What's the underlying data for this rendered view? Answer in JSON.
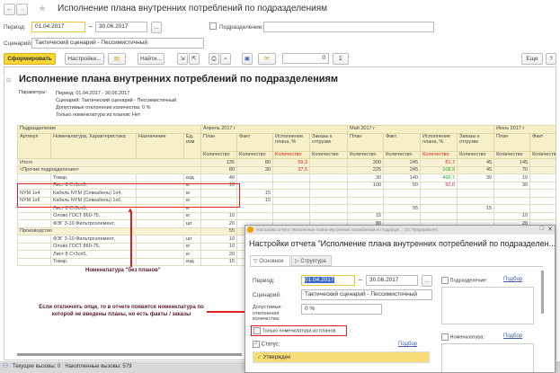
{
  "window": {
    "title": "Исполнение плана внутренних потреблений по подразделениям",
    "nav_back": "←",
    "nav_fwd": "→",
    "star": "★"
  },
  "filters": {
    "period_label": "Период:",
    "date_from": "01.04.2017",
    "date_to": "30.06.2017",
    "dash": "–",
    "dots": "...",
    "division_label": "Подразделение:",
    "division_value": "",
    "scenario_label": "Сценарий:",
    "scenario_value": "Тактический сценарий - Пессимистичный"
  },
  "toolbar": {
    "generate": "Сформировать",
    "settings": "Настройки...",
    "find": "Найти...",
    "sum_value": "0",
    "sigma": "Σ",
    "more": "Еще",
    "help": "?"
  },
  "report": {
    "title": "Исполнение плана внутренних потреблений по подразделениям",
    "params_label": "Параметры:",
    "params": [
      "Период: 01.04.2017 - 30.06.2017",
      "Сценарий: Тактический сценарий - Пессимистичный",
      "Допустимые отклонения количества: 0 %",
      "Только номенклатура из планов: Нет"
    ],
    "header": {
      "division": "Подразделение",
      "article": "Артикул",
      "item": "Номенклатура, Характеристика",
      "purpose": "Назначение",
      "unit": "Ед. изм",
      "months": [
        "Апрель 2017 г",
        "Май 2017 г",
        "Июнь 2017 г"
      ],
      "cols": [
        "План",
        "Факт",
        "Исполнение плана, %",
        "Заказы к отгрузке"
      ],
      "qty": "Количество"
    },
    "rows": [
      {
        "type": "total",
        "article": "Итого",
        "cells": [
          "135",
          "80",
          "59,3",
          "",
          "300",
          "245",
          "81,7",
          "45",
          "145",
          ""
        ]
      },
      {
        "type": "group",
        "article": "<Прочие подразделения>",
        "cells": [
          "80",
          "30",
          "37,5",
          "",
          "225",
          "245",
          "108,9",
          "45",
          "70",
          ""
        ]
      },
      {
        "type": "item",
        "article": "",
        "item": "Товар,",
        "unit": "изд",
        "cells": [
          "40",
          "",
          "",
          "",
          "30",
          "140",
          "466,7",
          "30",
          "10",
          ""
        ]
      },
      {
        "type": "item",
        "article": "",
        "item": "Лист 8 Ст3сп5,",
        "unit": "кг",
        "cells": [
          "10",
          "",
          "",
          "",
          "100",
          "50",
          "50,0",
          "",
          "30",
          ""
        ]
      },
      {
        "type": "item",
        "article": "NYM 1х4",
        "item": "Кабель NYM (Севкабель) 1х4,",
        "unit": "м",
        "cells": [
          "",
          "15",
          "",
          "",
          "",
          "",
          "",
          "",
          "",
          ""
        ]
      },
      {
        "type": "item",
        "article": "NYM 1х6",
        "item": "Кабель NYM (Севкабель) 1х6,",
        "unit": "м",
        "cells": [
          "",
          "15",
          "",
          "",
          "",
          "",
          "",
          "",
          "",
          ""
        ]
      },
      {
        "type": "item",
        "article": "",
        "item": "Лист 8 Ст3сп5,",
        "unit": "кг",
        "cells": [
          "",
          "",
          "",
          "",
          "",
          "55",
          "",
          "15",
          "",
          ""
        ]
      },
      {
        "type": "item",
        "article": "",
        "item": "Олово ГОСТ 860-75,",
        "unit": "кг",
        "cells": [
          "10",
          "",
          "",
          "",
          "15",
          "",
          "",
          "",
          "10",
          ""
        ]
      },
      {
        "type": "item",
        "article": "",
        "item": "ФЭГ 3-10 Фильтроэлемент,",
        "unit": "шт",
        "cells": [
          "20",
          "",
          "",
          "",
          "80",
          "",
          "",
          "",
          "20",
          ""
        ]
      },
      {
        "type": "group",
        "article": "Производство",
        "cells": [
          "55",
          "50",
          "90,9",
          "",
          "75",
          "",
          "",
          "",
          "75",
          ""
        ]
      },
      {
        "type": "item",
        "article": "",
        "item": "ФЭГ 3-10 Фильтроэлемент,",
        "unit": "шт",
        "cells": [
          "10",
          "30",
          "300,0",
          "",
          "30",
          "",
          "",
          "",
          "5",
          ""
        ]
      },
      {
        "type": "item",
        "article": "",
        "item": "Олово ГОСТ 860-75,",
        "unit": "кг",
        "cells": [
          "10",
          "",
          "",
          "",
          "",
          "",
          "",
          "",
          "",
          ""
        ]
      },
      {
        "type": "item",
        "article": "",
        "item": "Лист 8 Ст3сп5,",
        "unit": "кг",
        "cells": [
          "20",
          "",
          "",
          "",
          "",
          "",
          "",
          "",
          "",
          ""
        ]
      },
      {
        "type": "item",
        "article": "",
        "item": "Товар,",
        "unit": "изд",
        "cells": [
          "15",
          "",
          "",
          "",
          "",
          "",
          "",
          "",
          "",
          ""
        ]
      }
    ]
  },
  "annotations": {
    "no_plans": "Номенклатура \"без планов\"",
    "hint": "Если отключить опци, то в отчете появится номенклатура по которой не введены планы, но есть факты / заказы"
  },
  "statusbar": {
    "text": "Текущие вызовы: 0   Накопленные вызовы: 579"
  },
  "dialog": {
    "window_title": "Настройки отчета \"Исполнение плана внутренних потреблений по подразде... (1С:Предприятие)",
    "title": "Настройки отчета \"Исполнение плана внутренних потреблений по подразделен...",
    "tabs": [
      "Основное",
      "Структура"
    ],
    "period_label": "Период:",
    "date_from": "01.04.2017",
    "date_to": "30.06.2017",
    "scenario_label": "Сценарий:",
    "scenario_value": "Тактический сценарий - Пессимистичный",
    "deviation_label": "Допустимые отклонения количества:",
    "deviation_value": "0 %",
    "only_plans_label": "Только номенклатура из планов",
    "only_plans_checked": false,
    "status_label": "Статус:",
    "status_checked": true,
    "pick": "Подбор",
    "status_item": "Утвержден",
    "division_label": "Подразделение:",
    "nomenclature_label": "Номенклатура:"
  },
  "colors": {
    "accent": "#f5d633",
    "header_bg": "#f6f0c8",
    "highlight": "#e02020",
    "link": "#3a5fa8"
  }
}
